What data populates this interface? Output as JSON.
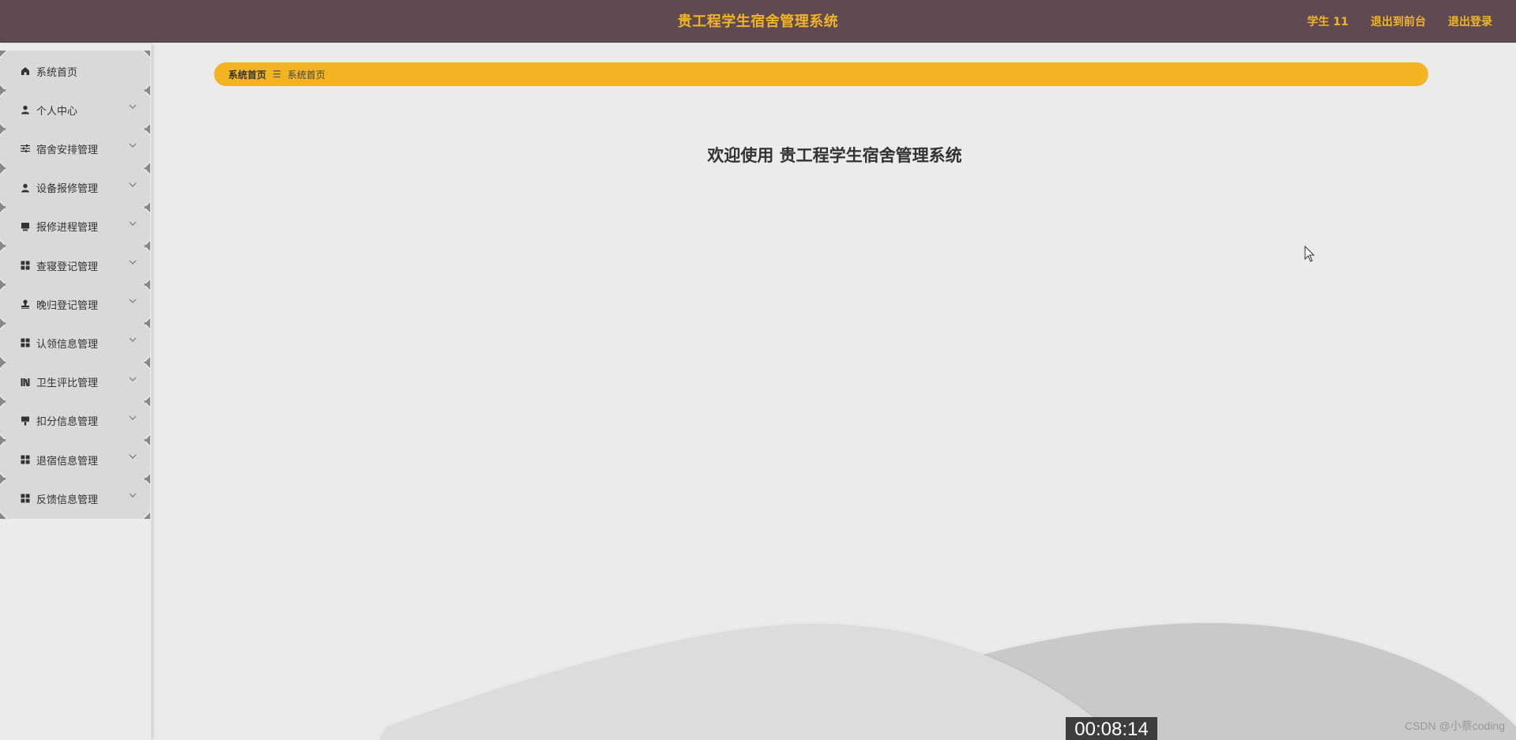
{
  "header": {
    "title": "贵工程学生宿舍管理系统",
    "user": "学生 11",
    "front_link": "退出到前台",
    "logout_link": "退出登录"
  },
  "colors": {
    "header_bg": "#5e4a50",
    "accent": "#f2b422",
    "page_bg": "#ebebeb",
    "menu_item_bg": "#d9d9d9"
  },
  "sidebar": {
    "items": [
      {
        "label": "系统首页",
        "icon": "home-icon",
        "has_submenu": false
      },
      {
        "label": "个人中心",
        "icon": "user-icon",
        "has_submenu": true
      },
      {
        "label": "宿舍安排管理",
        "icon": "sliders-icon",
        "has_submenu": true
      },
      {
        "label": "设备报修管理",
        "icon": "user-icon",
        "has_submenu": true
      },
      {
        "label": "报修进程管理",
        "icon": "monitor-icon",
        "has_submenu": true
      },
      {
        "label": "查寝登记管理",
        "icon": "grid-icon",
        "has_submenu": true
      },
      {
        "label": "晚归登记管理",
        "icon": "stamp-icon",
        "has_submenu": true
      },
      {
        "label": "认领信息管理",
        "icon": "grid-icon",
        "has_submenu": true
      },
      {
        "label": "卫生评比管理",
        "icon": "books-icon",
        "has_submenu": true
      },
      {
        "label": "扣分信息管理",
        "icon": "brush-icon",
        "has_submenu": true
      },
      {
        "label": "退宿信息管理",
        "icon": "grid-icon",
        "has_submenu": true
      },
      {
        "label": "反馈信息管理",
        "icon": "grid-icon",
        "has_submenu": true
      }
    ]
  },
  "breadcrumb": {
    "items": [
      "系统首页",
      "系统首页"
    ],
    "separator": "☰"
  },
  "main": {
    "welcome": "欢迎使用 贵工程学生宿舍管理系统"
  },
  "overlay": {
    "timestamp": "00:08:14",
    "watermark": "CSDN @小蔡coding"
  }
}
